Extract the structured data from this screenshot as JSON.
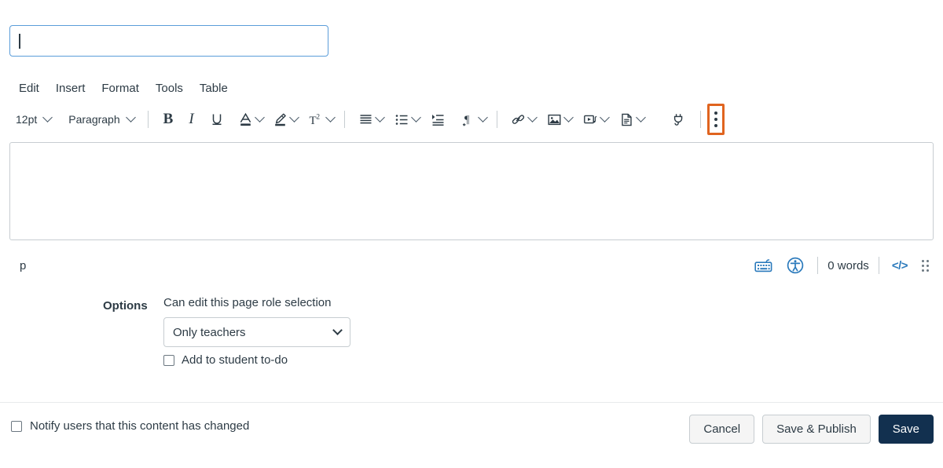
{
  "title_input": {
    "value": "",
    "placeholder": "",
    "name": "page-title-input"
  },
  "menubar": {
    "items": [
      {
        "label": "Edit"
      },
      {
        "label": "Insert"
      },
      {
        "label": "Format"
      },
      {
        "label": "Tools"
      },
      {
        "label": "Table"
      }
    ]
  },
  "toolbar": {
    "font_size": "12pt",
    "block_format": "Paragraph",
    "buttons": [
      {
        "icon": "bold-icon",
        "label": "B"
      },
      {
        "icon": "italic-icon",
        "label": "I"
      },
      {
        "icon": "underline-icon",
        "label": "U"
      },
      {
        "icon": "text-color-icon",
        "label": "A"
      },
      {
        "icon": "highlight-color-icon",
        "label": ""
      },
      {
        "icon": "superscript-subscript-icon",
        "label": "T2"
      },
      {
        "icon": "align-icon",
        "label": ""
      },
      {
        "icon": "bullet-list-icon",
        "label": ""
      },
      {
        "icon": "indent-icon",
        "label": ""
      },
      {
        "icon": "text-direction-icon",
        "label": ""
      },
      {
        "icon": "link-icon",
        "label": ""
      },
      {
        "icon": "image-icon",
        "label": ""
      },
      {
        "icon": "media-icon",
        "label": ""
      },
      {
        "icon": "document-icon",
        "label": ""
      },
      {
        "icon": "apps-plug-icon",
        "label": ""
      },
      {
        "icon": "kebab-menu-icon",
        "label": ""
      }
    ],
    "highlight_color": "#e0641f",
    "highlighted_button": "kebab-menu-icon"
  },
  "editor_body": {
    "content": ""
  },
  "statusbar": {
    "element_path": "p",
    "word_count": "0 words",
    "html_editor_label": "</>",
    "keyboard_shortcuts_icon": "keyboard-icon",
    "accessibility_icon": "accessibility-checker-icon",
    "resize_handle_icon": "resize-grip-icon",
    "accent_color": "#2b7abc"
  },
  "options": {
    "label": "Options",
    "role_selection_label": "Can edit this page role selection",
    "role_select_value": "Only teachers",
    "role_select_options": [
      "Only teachers"
    ],
    "todo_checkbox_label": "Add to student to-do",
    "todo_checked": false
  },
  "footer": {
    "notify_label": "Notify users that this content has changed",
    "notify_checked": false,
    "cancel_label": "Cancel",
    "save_publish_label": "Save & Publish",
    "save_label": "Save",
    "primary_color": "#12304f"
  }
}
